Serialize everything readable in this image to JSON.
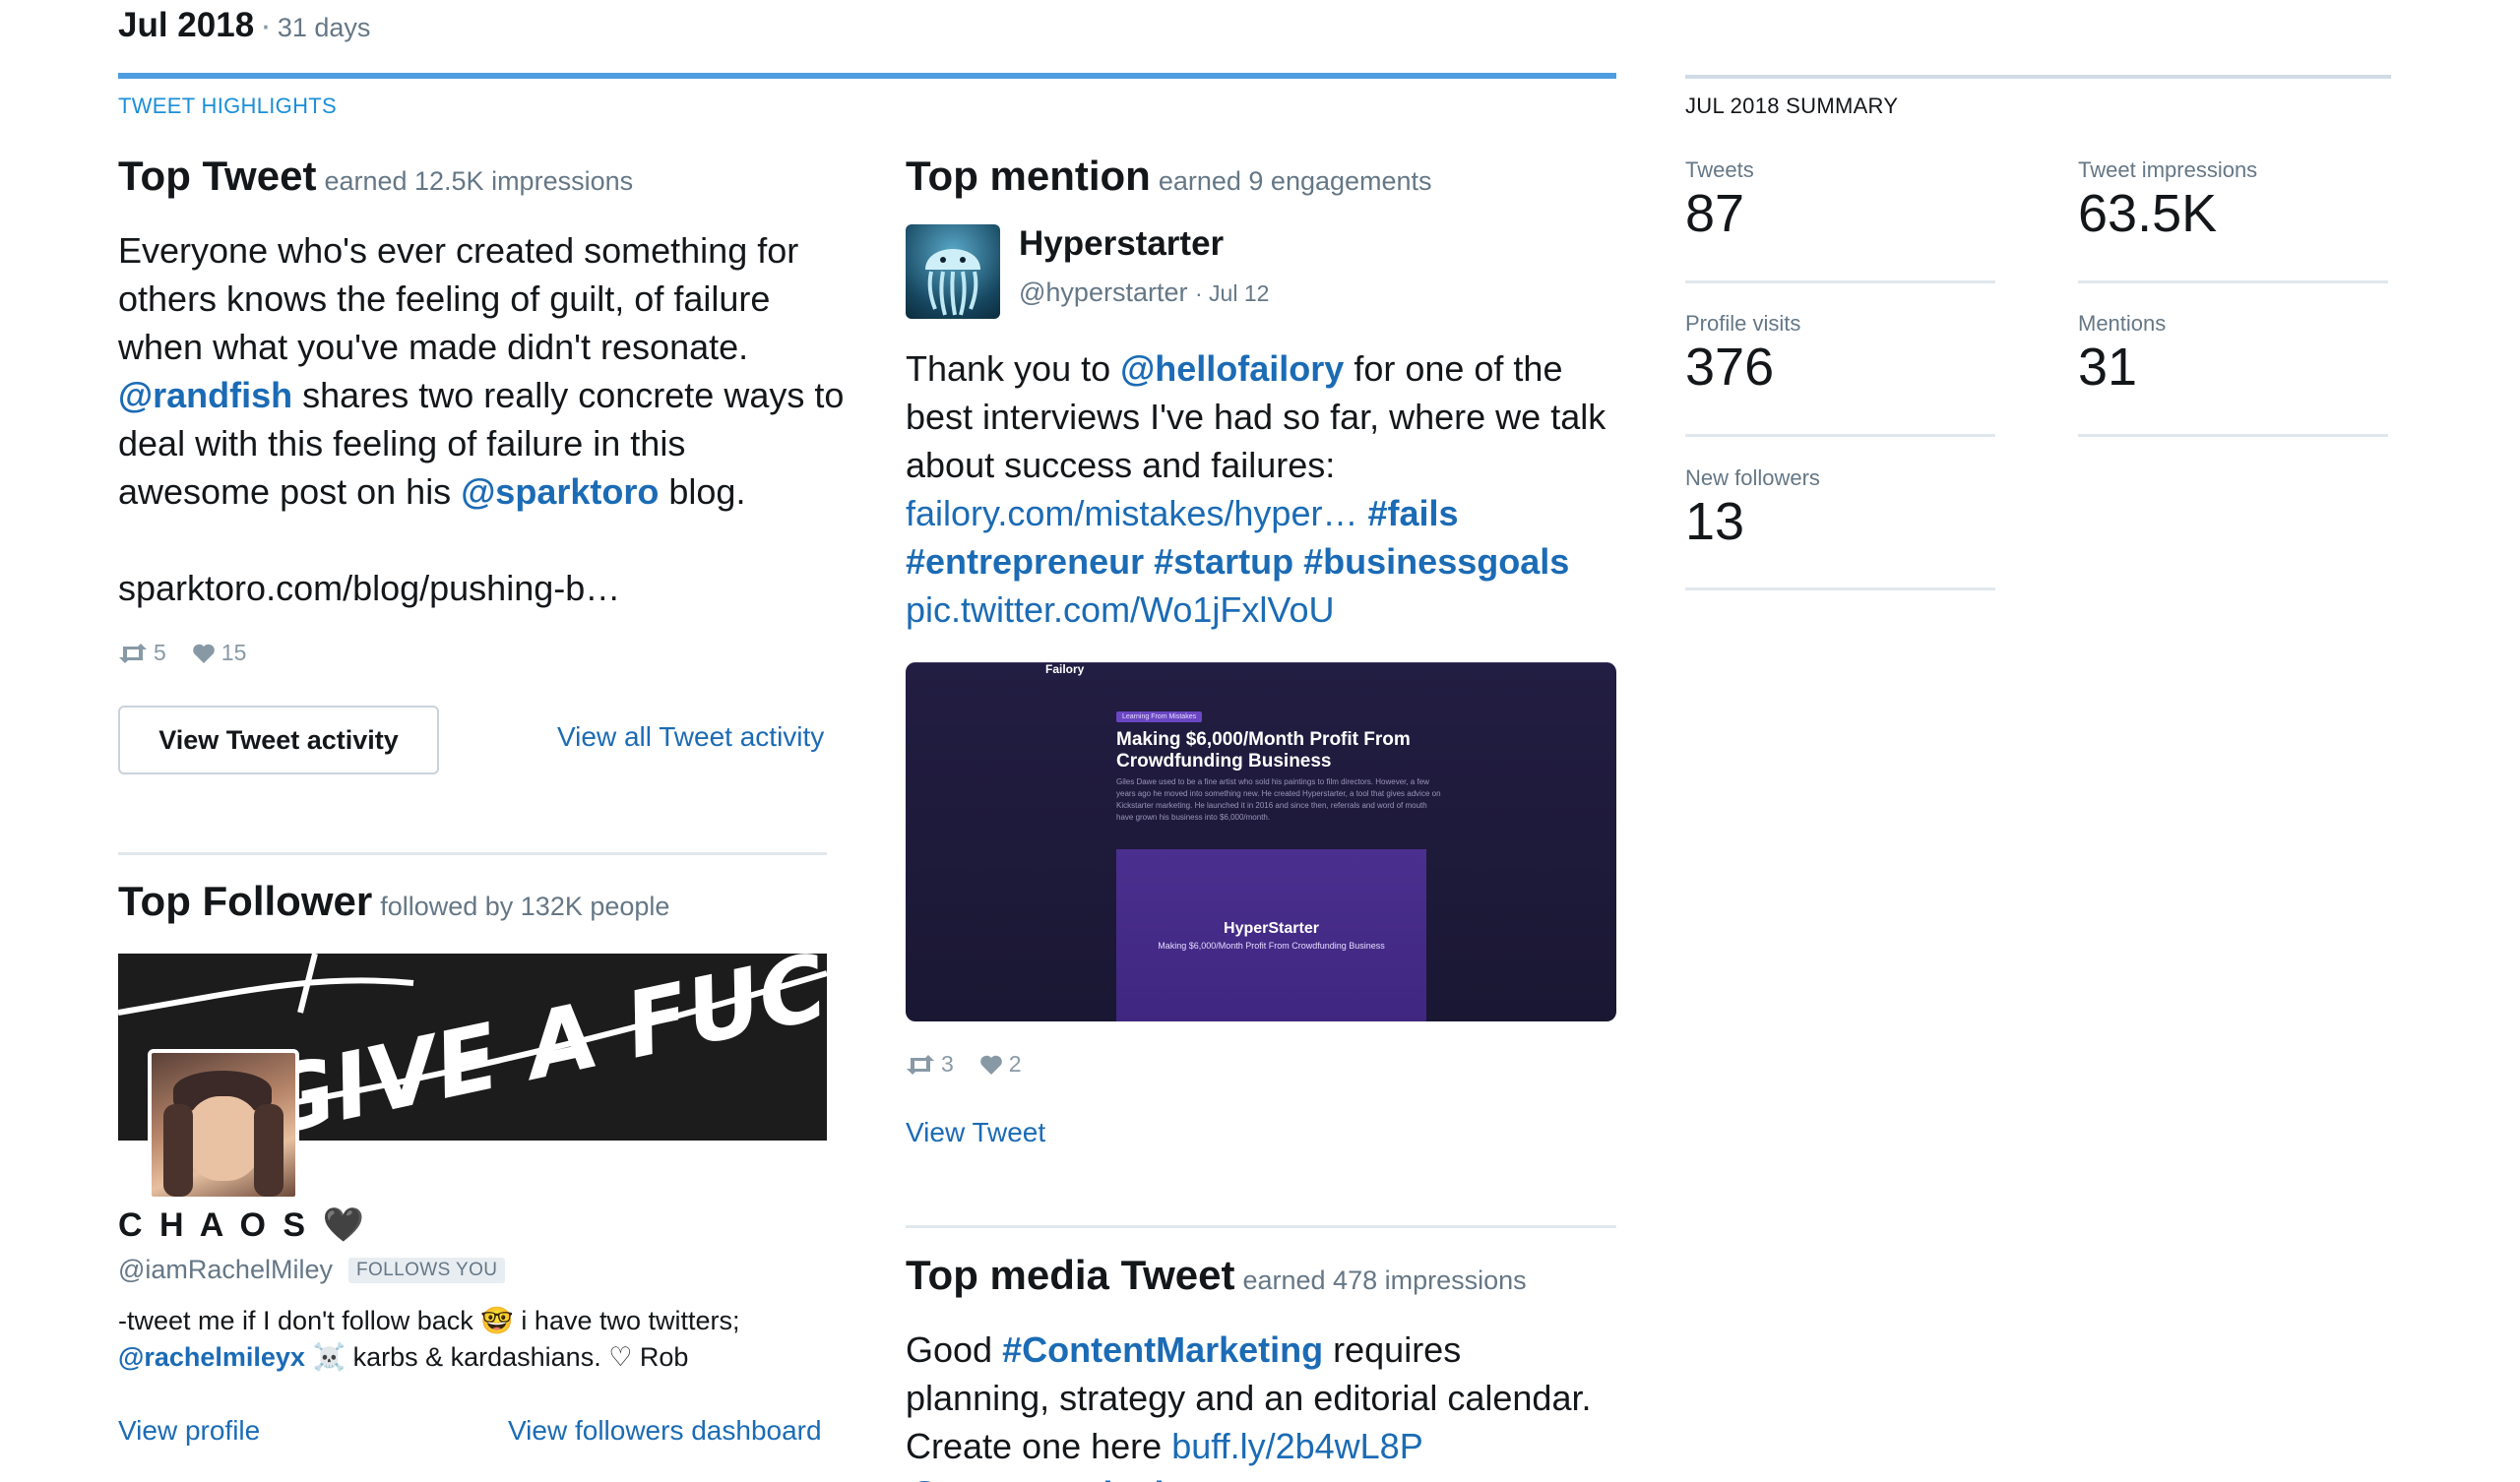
{
  "period": {
    "month": "Jul 2018",
    "separator": "·",
    "days": "31 days"
  },
  "highlights": {
    "section_label": "TWEET HIGHLIGHTS",
    "top_tweet": {
      "title": "Top Tweet",
      "subtitle": "earned 12.5K impressions",
      "text_1": "Everyone who's ever created something for others knows the feeling of guilt, of failure when what you've made didn't resonate.",
      "mention_1": "@randfish",
      "text_2": "shares two really concrete ways to deal with this feeling of failure in this awesome post on his",
      "mention_2": "@sparktoro",
      "text_3": "blog.",
      "url": "sparktoro.com/blog/pushing-b…",
      "retweets": "5",
      "likes": "15",
      "view_activity_button": "View Tweet activity",
      "view_all_link": "View all Tweet activity"
    },
    "top_follower": {
      "title": "Top Follower",
      "subtitle": "followed by 132K people",
      "banner_text": "GIVE A FUCK·",
      "name": "C H A O S 🖤",
      "handle": "@iamRachelMiley",
      "follows_badge": "FOLLOWS YOU",
      "bio_1": "-tweet me if I don't follow back 🤓   i have two twitters;",
      "bio_mention": "@rachelmileyx",
      "bio_2": "☠️   karbs & kardashians. ♡ Rob",
      "view_profile_link": "View profile",
      "view_followers_link": "View followers dashboard"
    },
    "top_mention": {
      "title": "Top mention",
      "subtitle": "earned 9 engagements",
      "author_name": "Hyperstarter",
      "author_handle": "@hyperstarter",
      "date": "· Jul 12",
      "text_1": "Thank you to",
      "mention": "@hellofailory",
      "text_2": "for one of the best interviews I've had so far, where we talk about success and failures:",
      "url": "failory.com/mistakes/hyper…",
      "hashtags": [
        "#fails",
        "#entrepreneur",
        "#startup",
        "#businessgoals"
      ],
      "pic_url": "pic.twitter.com/Wo1jFxlVoU",
      "media": {
        "brand": "Failory",
        "tag": "Learning From Mistakes",
        "headline": "Making $6,000/Month Profit From Crowdfunding Business",
        "body": "Giles Dawe used to be a fine artist who sold his paintings to film directors. However, a few years ago he moved into something new. He created Hyperstarter, a tool that gives advice on Kickstarter marketing. He launched it in 2016 and since then, referrals and word of mouth have grown his business into $6,000/month.",
        "card_title": "HyperStarter",
        "card_sub": "Making $6,000/Month Profit From Crowdfunding Business"
      },
      "retweets": "3",
      "likes": "2",
      "view_tweet_link": "View Tweet"
    },
    "top_media": {
      "title": "Top media Tweet",
      "subtitle": "earned 478 impressions",
      "text_1": "Good",
      "hashtag": "#ContentMarketing",
      "text_2": "requires planning, strategy and an editorial calendar. Create one here",
      "url": "buff.ly/2b4wL8P",
      "mention_partial": "@WeAreArticulate"
    }
  },
  "summary": {
    "section_label": "JUL 2018 SUMMARY",
    "metrics": [
      {
        "label": "Tweets",
        "value": "87"
      },
      {
        "label": "Tweet impressions",
        "value": "63.5K"
      },
      {
        "label": "Profile visits",
        "value": "376"
      },
      {
        "label": "Mentions",
        "value": "31"
      },
      {
        "label": "New followers",
        "value": "13"
      }
    ]
  },
  "colors": {
    "link": "#1b6bb5",
    "accent_rule": "#4d9de0",
    "media_bg": "#1f1b3c",
    "media_card": "#4a2f8c"
  }
}
